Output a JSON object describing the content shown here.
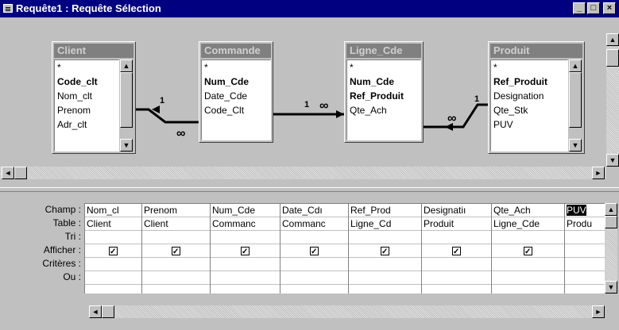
{
  "window": {
    "title": "Requête1 : Requête Sélection",
    "minimize_label": "_",
    "maximize_label": "□",
    "close_label": "×"
  },
  "tables": [
    {
      "name": "Client",
      "fields": [
        {
          "label": "*",
          "key": false
        },
        {
          "label": "Code_clt",
          "key": true
        },
        {
          "label": "Nom_clt",
          "key": false
        },
        {
          "label": "Prenom",
          "key": false
        },
        {
          "label": "Adr_clt",
          "key": false
        }
      ]
    },
    {
      "name": "Commande",
      "fields": [
        {
          "label": "*",
          "key": false
        },
        {
          "label": "Num_Cde",
          "key": true
        },
        {
          "label": "Date_Cde",
          "key": false
        },
        {
          "label": "Code_Clt",
          "key": false
        }
      ]
    },
    {
      "name": "Ligne_Cde",
      "fields": [
        {
          "label": "*",
          "key": false
        },
        {
          "label": "Num_Cde",
          "key": true
        },
        {
          "label": "Ref_Produit",
          "key": true
        },
        {
          "label": "Qte_Ach",
          "key": false
        }
      ]
    },
    {
      "name": "Produit",
      "fields": [
        {
          "label": "*",
          "key": false
        },
        {
          "label": "Ref_Produit",
          "key": true
        },
        {
          "label": "Designation",
          "key": false
        },
        {
          "label": "Qte_Stk",
          "key": false
        },
        {
          "label": "PUV",
          "key": false
        }
      ]
    }
  ],
  "relations": [
    {
      "one": "1",
      "many": "∞"
    },
    {
      "one": "1",
      "many": "∞"
    },
    {
      "one": "1",
      "many": "∞"
    }
  ],
  "grid": {
    "row_labels": [
      "Champ :",
      "Table :",
      "Tri :",
      "Afficher :",
      "Critères :",
      "Ou :"
    ],
    "columns": [
      {
        "champ": "Nom_cl",
        "table": "Client",
        "afficher": true
      },
      {
        "champ": "Prenom",
        "table": "Client",
        "afficher": true
      },
      {
        "champ": "Num_Cde",
        "table": "Commanc",
        "afficher": true
      },
      {
        "champ": "Date_Cdı",
        "table": "Commanc",
        "afficher": true
      },
      {
        "champ": "Ref_Prod",
        "table": "Ligne_Cd",
        "afficher": true
      },
      {
        "champ": "Designatiı",
        "table": "Produit",
        "afficher": true
      },
      {
        "champ": "Qte_Ach",
        "table": "Ligne_Cde",
        "afficher": true
      },
      {
        "champ": "PUV",
        "table": "Produ",
        "afficher": false,
        "selected": true
      }
    ]
  },
  "icons": {
    "arrow_up": "▲",
    "arrow_down": "▼",
    "arrow_left": "◄",
    "arrow_right": "►"
  }
}
